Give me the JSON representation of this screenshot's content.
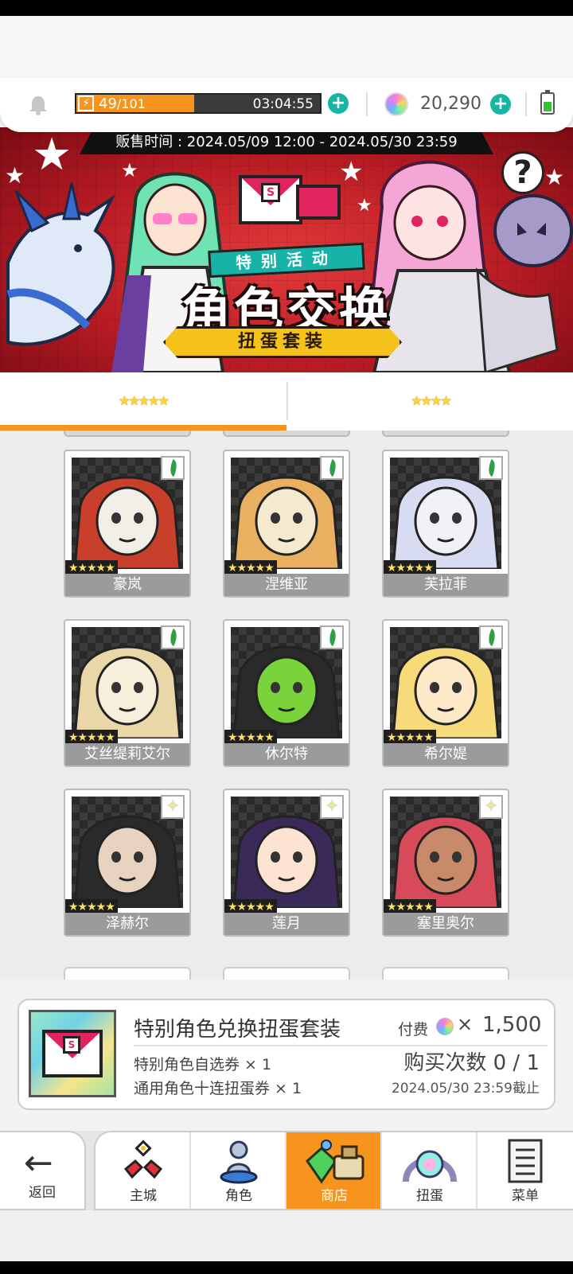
{
  "resources": {
    "energy_current": "49",
    "energy_max": "/101",
    "energy_fraction": 0.485,
    "energy_timer": "03:04:55",
    "gem_count": "20,290",
    "plus_symbol": "+"
  },
  "banner": {
    "sale_time": "贩售时间 : 2024.05/09 12:00 - 2024.05/30 23:59",
    "event_tag": "特别活动",
    "title": "角色交换",
    "subtitle": "扭蛋套装",
    "help_symbol": "?"
  },
  "tabs": [
    {
      "label": "★★★★★",
      "active": true
    },
    {
      "label": "★★★★",
      "active": false
    }
  ],
  "characters": [
    {
      "name": "豪岚",
      "stars": "★★★★★",
      "element": "leaf"
    },
    {
      "name": "涅维亚",
      "stars": "★★★★★",
      "element": "leaf"
    },
    {
      "name": "芙拉菲",
      "stars": "★★★★★",
      "element": "leaf"
    },
    {
      "name": "艾丝缇莉艾尔",
      "stars": "★★★★★",
      "element": "leaf"
    },
    {
      "name": "休尔特",
      "stars": "★★★★★",
      "element": "leaf"
    },
    {
      "name": "希尔媞",
      "stars": "★★★★★",
      "element": "leaf"
    },
    {
      "name": "泽赫尔",
      "stars": "★★★★★",
      "element": "spark"
    },
    {
      "name": "莲月",
      "stars": "★★★★★",
      "element": "spark"
    },
    {
      "name": "塞里奥尔",
      "stars": "★★★★★",
      "element": "spark"
    }
  ],
  "package": {
    "title": "特别角色兑换扭蛋套装",
    "item1": "特别角色自选券 × 1",
    "item2": "通用角色十连扭蛋券 × 1",
    "price_label": "付费",
    "price_x": "×",
    "price_value": "1,500",
    "buy_count": "购买次数 0 / 1",
    "deadline": "2024.05/30 23:59截止"
  },
  "nav": {
    "back": "返回",
    "items": [
      {
        "label": "主城",
        "icon": "castle-icon"
      },
      {
        "label": "角色",
        "icon": "character-icon"
      },
      {
        "label": "商店",
        "icon": "shop-icon",
        "active": true
      },
      {
        "label": "扭蛋",
        "icon": "gacha-icon"
      },
      {
        "label": "菜单",
        "icon": "menu-icon"
      }
    ]
  },
  "colors": {
    "accent": "#f7941d",
    "plus": "#17b6a4",
    "banner_red": "#c8202a"
  }
}
